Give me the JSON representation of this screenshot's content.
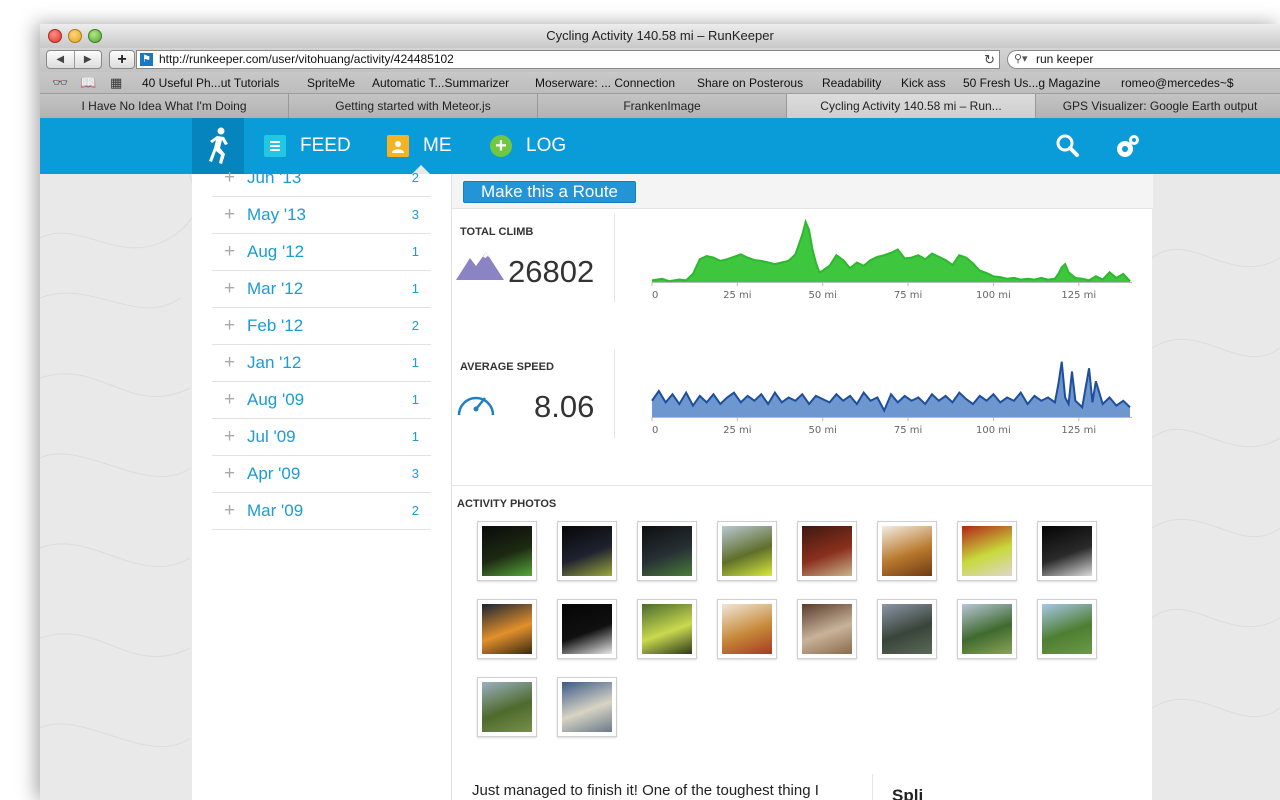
{
  "window": {
    "title": "Cycling Activity 140.58 mi – RunKeeper"
  },
  "browser": {
    "url": "http://runkeeper.com/user/vitohuang/activity/424485102",
    "search_query": "run keeper",
    "bookmarks": [
      "40 Useful Ph...ut Tutorials",
      "SpriteMe",
      "Automatic T...Summarizer",
      "Moserware: ... Connection",
      "Share on Posterous",
      "Readability",
      "Kick ass",
      "50 Fresh Us...g Magazine",
      "romeo@mercedes~$"
    ],
    "tabs": [
      {
        "label": "I Have No Idea What I'm Doing",
        "active": false
      },
      {
        "label": "Getting started with Meteor.js",
        "active": false
      },
      {
        "label": "FrankenImage",
        "active": false
      },
      {
        "label": "Cycling Activity 140.58 mi – Run...",
        "active": true
      },
      {
        "label": "GPS Visualizer: Google Earth output",
        "active": false
      }
    ]
  },
  "nav": {
    "feed": "FEED",
    "me": "ME",
    "log": "LOG"
  },
  "months": [
    {
      "label": "Jun '13",
      "count": "2"
    },
    {
      "label": "May '13",
      "count": "3"
    },
    {
      "label": "Aug '12",
      "count": "1"
    },
    {
      "label": "Mar '12",
      "count": "1"
    },
    {
      "label": "Feb '12",
      "count": "2"
    },
    {
      "label": "Jan '12",
      "count": "1"
    },
    {
      "label": "Aug '09",
      "count": "1"
    },
    {
      "label": "Jul '09",
      "count": "1"
    },
    {
      "label": "Apr '09",
      "count": "3"
    },
    {
      "label": "Mar '09",
      "count": "2"
    }
  ],
  "route_button": "Make this a Route",
  "stats": {
    "total_climb": {
      "label": "TOTAL CLIMB",
      "value": "26802"
    },
    "average_speed": {
      "label": "AVERAGE SPEED",
      "value": "8.06"
    }
  },
  "chart_data": [
    {
      "type": "area",
      "title": "TOTAL CLIMB",
      "color": "#2db82d",
      "fill": "#3fc63f",
      "x_ticks": [
        "0",
        "25 mi",
        "50 mi",
        "75 mi",
        "100 mi",
        "125 mi"
      ],
      "xlim": [
        0,
        140.58
      ],
      "x": [
        0,
        3,
        5,
        8,
        10,
        12,
        14,
        16,
        18,
        20,
        22,
        24,
        26,
        28,
        30,
        32,
        34,
        36,
        38,
        40,
        42,
        44,
        45,
        46,
        47,
        48,
        49,
        50,
        52,
        54,
        56,
        58,
        60,
        62,
        64,
        66,
        68,
        70,
        72,
        74,
        76,
        78,
        80,
        82,
        84,
        86,
        88,
        90,
        92,
        94,
        96,
        98,
        100,
        102,
        104,
        106,
        108,
        110,
        112,
        114,
        116,
        118,
        119,
        120,
        121,
        122,
        124,
        126,
        128,
        130,
        132,
        134,
        136,
        138,
        140
      ],
      "values": [
        2,
        4,
        1,
        3,
        2,
        10,
        28,
        32,
        30,
        26,
        28,
        31,
        34,
        30,
        27,
        26,
        24,
        22,
        24,
        26,
        34,
        58,
        74,
        64,
        40,
        24,
        12,
        14,
        20,
        33,
        27,
        17,
        24,
        20,
        27,
        31,
        33,
        36,
        40,
        29,
        30,
        33,
        28,
        35,
        31,
        27,
        21,
        33,
        30,
        23,
        14,
        11,
        7,
        6,
        4,
        5,
        3,
        4,
        3,
        5,
        3,
        4,
        10,
        18,
        22,
        12,
        5,
        4,
        2,
        7,
        3,
        12,
        5,
        10,
        1
      ],
      "ylim": [
        0,
        80
      ]
    },
    {
      "type": "area",
      "title": "AVERAGE SPEED",
      "color": "#1e4e9c",
      "fill": "#6f97cf",
      "x_ticks": [
        "0",
        "25 mi",
        "50 mi",
        "75 mi",
        "100 mi",
        "125 mi"
      ],
      "xlim": [
        0,
        140.58
      ],
      "x": [
        0,
        2,
        4,
        6,
        8,
        10,
        12,
        14,
        16,
        18,
        20,
        22,
        24,
        26,
        28,
        30,
        32,
        34,
        36,
        38,
        40,
        42,
        44,
        46,
        48,
        50,
        52,
        54,
        56,
        58,
        60,
        62,
        64,
        66,
        68,
        70,
        72,
        74,
        76,
        78,
        80,
        82,
        84,
        86,
        88,
        90,
        92,
        94,
        96,
        98,
        100,
        102,
        104,
        106,
        108,
        110,
        112,
        114,
        116,
        118,
        119,
        120,
        121,
        122,
        123,
        124,
        126,
        128,
        129,
        130,
        132,
        134,
        136,
        138,
        140
      ],
      "values": [
        10,
        16,
        9,
        14,
        8,
        15,
        7,
        13,
        9,
        14,
        8,
        12,
        15,
        9,
        13,
        10,
        14,
        8,
        15,
        9,
        12,
        10,
        14,
        8,
        13,
        11,
        9,
        14,
        10,
        13,
        8,
        15,
        10,
        12,
        4,
        14,
        9,
        13,
        10,
        12,
        8,
        14,
        10,
        13,
        9,
        15,
        11,
        8,
        13,
        10,
        14,
        9,
        12,
        10,
        15,
        8,
        13,
        10,
        12,
        9,
        20,
        34,
        12,
        8,
        28,
        10,
        6,
        30,
        9,
        22,
        8,
        12,
        7,
        10,
        6
      ],
      "ylim": [
        0,
        40
      ]
    }
  ],
  "photos_title": "ACTIVITY PHOTOS",
  "photos": [
    {
      "colors": [
        "#0b0b0b",
        "#1d2a12",
        "#58a73a"
      ]
    },
    {
      "colors": [
        "#070707",
        "#1f2230",
        "#9ba83e"
      ]
    },
    {
      "colors": [
        "#0d0f10",
        "#273035",
        "#4b7d3a"
      ]
    },
    {
      "colors": [
        "#b9c8d2",
        "#5f6f2a",
        "#d7e93e"
      ]
    },
    {
      "colors": [
        "#3d1a0f",
        "#8a2f1d",
        "#c9b48b"
      ]
    },
    {
      "colors": [
        "#f3ede2",
        "#b97a2e",
        "#6f3a14"
      ]
    },
    {
      "colors": [
        "#b22418",
        "#c8d93c",
        "#ddd7c9"
      ]
    },
    {
      "colors": [
        "#050505",
        "#2a2a2a",
        "#dadada"
      ]
    },
    {
      "colors": [
        "#1a2434",
        "#e2902a",
        "#3a2a14"
      ]
    },
    {
      "colors": [
        "#050505",
        "#101010",
        "#e8e8e8"
      ]
    },
    {
      "colors": [
        "#4a6a2e",
        "#c9d94e",
        "#2e3a1c"
      ]
    },
    {
      "colors": [
        "#f0e7d8",
        "#c78a3a",
        "#a53b22"
      ]
    },
    {
      "colors": [
        "#5a3b2a",
        "#c8b39a",
        "#8a6a4a"
      ]
    },
    {
      "colors": [
        "#8c96a6",
        "#39443a",
        "#5a6a58"
      ]
    },
    {
      "colors": [
        "#b8c6d6",
        "#3f6a2e",
        "#8aa35a"
      ]
    },
    {
      "colors": [
        "#a8c7e6",
        "#4d7e32",
        "#6b9a44"
      ]
    },
    {
      "colors": [
        "#9ab0c0",
        "#4e6a2c",
        "#76904a"
      ]
    },
    {
      "colors": [
        "#3c5a8a",
        "#d8d4c4",
        "#6a7a8a"
      ]
    }
  ],
  "description": "Just managed to finish it! One of the toughest thing I",
  "side_heading": "Spli"
}
